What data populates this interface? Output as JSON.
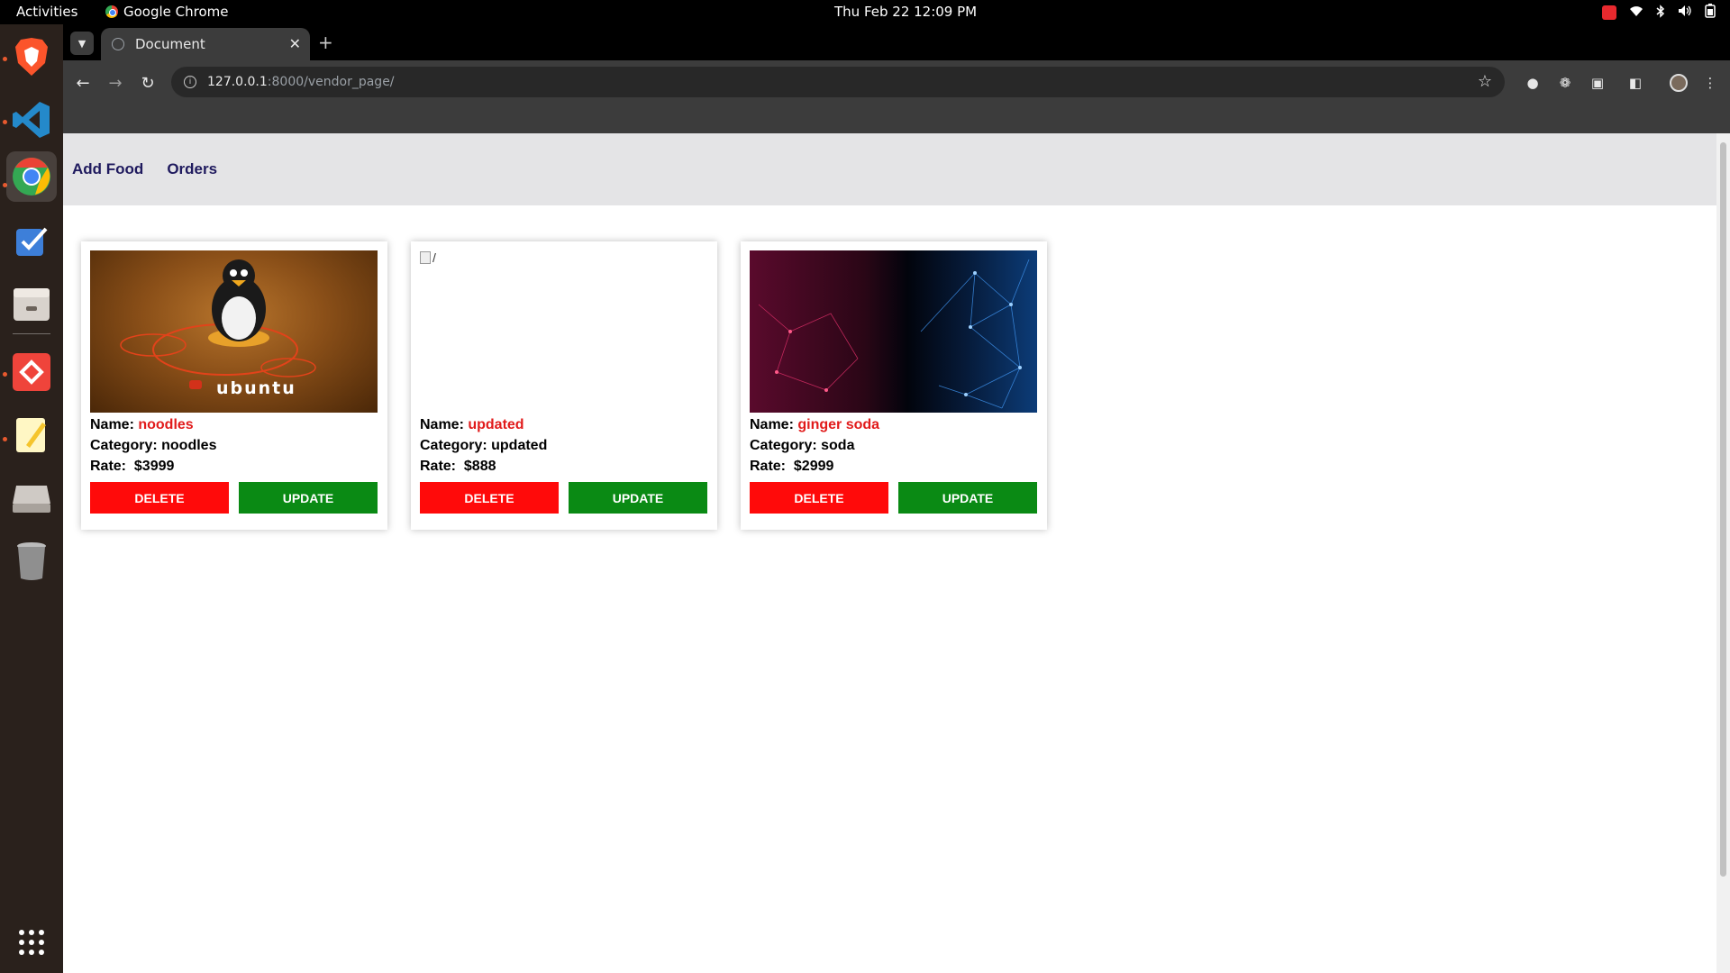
{
  "topbar": {
    "activities": "Activities",
    "app_name": "Google Chrome",
    "clock": "Thu Feb 22  12:09 PM"
  },
  "dock": {
    "items": [
      "brave-browser",
      "vs-code",
      "google-chrome",
      "tasks",
      "file-manager",
      "anydesk",
      "text-editor",
      "disk",
      "trash",
      "app-grid"
    ]
  },
  "browser": {
    "tab_title": "Document",
    "url_host": "127.0.0.1",
    "url_path": ":8000/vendor_page/"
  },
  "nav": {
    "add_food": "Add Food",
    "orders": "Orders"
  },
  "labels": {
    "name": "Name: ",
    "category": "Category: ",
    "rate": "Rate:  "
  },
  "cards": [
    {
      "name": "noodles",
      "category": "noodles",
      "rate": "$3999",
      "image": "ubuntu-penguin",
      "delete": "DELETE",
      "update": "UPDATE"
    },
    {
      "name": "updated",
      "category": "updated",
      "rate": "$888",
      "image_alt": "/",
      "delete": "DELETE",
      "update": "UPDATE"
    },
    {
      "name": "ginger soda",
      "category": "soda",
      "rate": "$2999",
      "image": "red-blue-network",
      "delete": "DELETE",
      "update": "UPDATE"
    }
  ],
  "colors": {
    "nav_link": "#1f1a5e",
    "name_value": "#e11b1b",
    "delete_button": "#ff0a0a",
    "update_button": "#0a8a14"
  }
}
